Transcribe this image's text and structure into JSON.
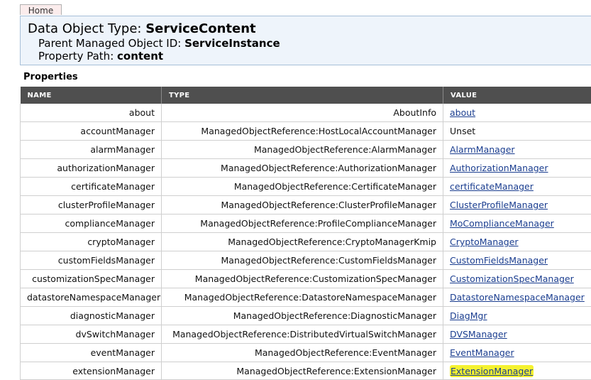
{
  "nav": {
    "home_label": "Home"
  },
  "header": {
    "title_prefix": "Data Object Type: ",
    "title_value": "ServiceContent",
    "parent_prefix": "Parent Managed Object ID: ",
    "parent_value": "ServiceInstance",
    "path_prefix": "Property Path: ",
    "path_value": "content"
  },
  "properties": {
    "heading": "Properties",
    "columns": [
      "NAME",
      "TYPE",
      "VALUE"
    ],
    "rows": [
      {
        "name": "about",
        "type": "AboutInfo",
        "value": "about",
        "is_link": true
      },
      {
        "name": "accountManager",
        "type": "ManagedObjectReference:HostLocalAccountManager",
        "value": "Unset",
        "is_link": false
      },
      {
        "name": "alarmManager",
        "type": "ManagedObjectReference:AlarmManager",
        "value": "AlarmManager",
        "is_link": true
      },
      {
        "name": "authorizationManager",
        "type": "ManagedObjectReference:AuthorizationManager",
        "value": "AuthorizationManager",
        "is_link": true
      },
      {
        "name": "certificateManager",
        "type": "ManagedObjectReference:CertificateManager",
        "value": "certificateManager",
        "is_link": true
      },
      {
        "name": "clusterProfileManager",
        "type": "ManagedObjectReference:ClusterProfileManager",
        "value": "ClusterProfileManager",
        "is_link": true
      },
      {
        "name": "complianceManager",
        "type": "ManagedObjectReference:ProfileComplianceManager",
        "value": "MoComplianceManager",
        "is_link": true
      },
      {
        "name": "cryptoManager",
        "type": "ManagedObjectReference:CryptoManagerKmip",
        "value": "CryptoManager",
        "is_link": true
      },
      {
        "name": "customFieldsManager",
        "type": "ManagedObjectReference:CustomFieldsManager",
        "value": "CustomFieldsManager",
        "is_link": true
      },
      {
        "name": "customizationSpecManager",
        "type": "ManagedObjectReference:CustomizationSpecManager",
        "value": "CustomizationSpecManager",
        "is_link": true
      },
      {
        "name": "datastoreNamespaceManager",
        "type": "ManagedObjectReference:DatastoreNamespaceManager",
        "value": "DatastoreNamespaceManager",
        "is_link": true
      },
      {
        "name": "diagnosticManager",
        "type": "ManagedObjectReference:DiagnosticManager",
        "value": "DiagMgr",
        "is_link": true
      },
      {
        "name": "dvSwitchManager",
        "type": "ManagedObjectReference:DistributedVirtualSwitchManager",
        "value": "DVSManager",
        "is_link": true
      },
      {
        "name": "eventManager",
        "type": "ManagedObjectReference:EventManager",
        "value": "EventManager",
        "is_link": true
      },
      {
        "name": "extensionManager",
        "type": "ManagedObjectReference:ExtensionManager",
        "value": "ExtensionManager",
        "is_link": true,
        "highlighted": true
      }
    ]
  },
  "colors": {
    "header_bg": "#eef4fb",
    "table_header_bg": "#4f4f4f",
    "link": "#1a3d8f",
    "highlight": "#f5f230"
  }
}
